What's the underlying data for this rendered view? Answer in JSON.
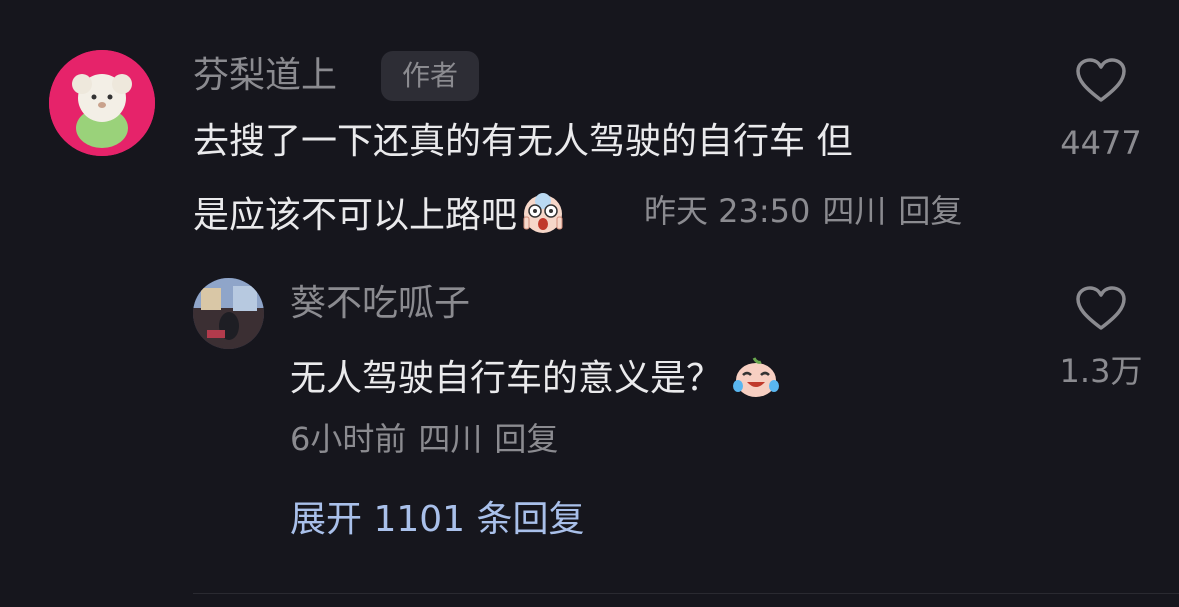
{
  "comment": {
    "username": "芬梨道上",
    "badge": "作者",
    "text_line1": "去搜了一下还真的有无人驾驶的自行车  但",
    "text_line2": "是应该不可以上路吧",
    "time": "昨天 23:50",
    "location": "四川",
    "reply_label": "回复",
    "like_count": "4477",
    "emoji": "screaming-face-emoji"
  },
  "reply": {
    "username": "葵不吃呱子",
    "text": "无人驾驶自行车的意义是？",
    "time": "6小时前",
    "location": "四川",
    "reply_label": "回复",
    "like_count": "1.3万",
    "emoji": "laughing-crying-face-emoji"
  },
  "expand_label": "展开 1101 条回复",
  "icons": {
    "like": "heart-outline-icon"
  },
  "colors": {
    "background": "#16161d",
    "text_primary": "#eaeaec",
    "text_secondary": "#8b8b90",
    "link": "#a9c0ea",
    "avatar_main_bg": "#e6236a"
  }
}
